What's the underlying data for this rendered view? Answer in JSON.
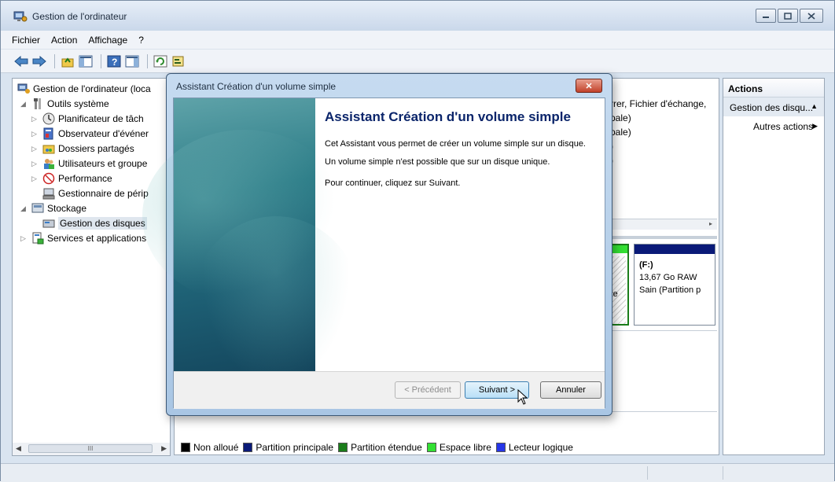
{
  "window": {
    "title": "Gestion de l'ordinateur"
  },
  "menu": [
    "Fichier",
    "Action",
    "Affichage",
    "?"
  ],
  "tree": {
    "root": "Gestion de l'ordinateur (loca",
    "outils": "Outils système",
    "planificateur": "Planificateur de tâch",
    "observateur": "Observateur d'événer",
    "dossiers": "Dossiers partagés",
    "utilisateurs": "Utilisateurs et groupe",
    "performance": "Performance",
    "gestionnaire": "Gestionnaire de périp",
    "stockage": "Stockage",
    "gestion_disques": "Gestion des disques",
    "services": "Services et applications"
  },
  "hscroll_mark": "III",
  "background_list": {
    "line1": "rrer, Fichier d'échange,",
    "line2": "pale)",
    "line3": "pale)",
    "line4": ")",
    "line5": ")"
  },
  "disk": {
    "label": "(F:)",
    "size": "13,67 Go RAW",
    "status": "Sain (Partition p",
    "partial": "re"
  },
  "legend": [
    {
      "label": "Non alloué",
      "color": "#000000"
    },
    {
      "label": "Partition principale",
      "color": "#0a1a78"
    },
    {
      "label": "Partition étendue",
      "color": "#1a7d1a"
    },
    {
      "label": "Espace libre",
      "color": "#33e033"
    },
    {
      "label": "Lecteur logique",
      "color": "#2636e8"
    }
  ],
  "actions": {
    "header": "Actions",
    "section": "Gestion des disqu...",
    "item": "Autres actions"
  },
  "dialog": {
    "title": "Assistant Création d'un volume simple",
    "heading": "Assistant Création d'un volume simple",
    "p1": "Cet Assistant vous permet de créer un volume simple sur un disque.",
    "p2": "Un volume simple n'est possible que sur un disque unique.",
    "p3": "Pour continuer, cliquez sur Suivant.",
    "btn_prev": "< Précédent",
    "btn_next": "Suivant >",
    "btn_cancel": "Annuler",
    "close_glyph": "✕"
  }
}
